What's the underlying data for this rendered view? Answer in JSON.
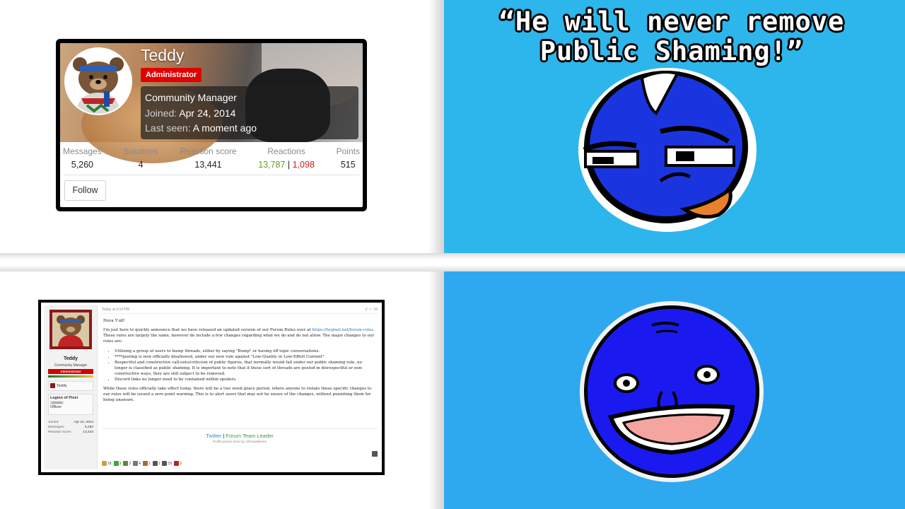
{
  "profile_card": {
    "username": "Teddy",
    "role_badge": "Administrator",
    "title": "Community Manager",
    "joined_label": "Joined:",
    "joined_value": "Apr 24, 2014",
    "last_seen_label": "Last seen:",
    "last_seen_value": "A moment ago",
    "stats": {
      "messages_label": "Messages",
      "messages_value": "5,260",
      "solutions_label": "Solutions",
      "solutions_value": "4",
      "reaction_score_label": "Reaction score",
      "reaction_score_value": "13,441",
      "reactions_label": "Reactions",
      "reactions_positive": "13,787",
      "reactions_separator": " | ",
      "reactions_negative": "1,098",
      "points_label": "Points",
      "points_value": "515"
    },
    "follow_label": "Follow"
  },
  "forum_post": {
    "timestamp": "Today at 4:14 PM",
    "post_number": "#3",
    "author": {
      "name": "Teddy",
      "title": "Community Manager",
      "badge": "Administrator",
      "team_name": "Teddy",
      "guild_name": "Legion of Pixel",
      "guild_tag": "LEGION",
      "guild_rank": "Officer",
      "joined_label": "Joined:",
      "joined_value": "Apr 24, 2014",
      "messages_label": "Messages:",
      "messages_value": "5,260",
      "reaction_score_label": "Reaction score:",
      "reaction_score_value": "13,443"
    },
    "greeting": "Heya Y'all!",
    "intro_before_link": "I'm just here to quickly announce that we have released an updated version of our Forum Rules over at ",
    "rules_link": "https://hypixel.net/forum-rules",
    "intro_after_link": ". These rules are largely the same, however do include a few changes regarding what we do and do not allow. The major changes to our rules are:",
    "bullets": [
      "Utilizing a group of users to bump threads, either by saying \"Bump\" or having off topic conversations.",
      "****posting is now officially disallowed, under our new rule against \"Low-Quality or Low-Effort Content\"",
      "Respectful and constructive call-outs/criticism of public figures, that normally would fall under our public shaming rule, no longer is classified as public shaming. It is important to note that if these sort of threads are posted in disrespectful or non-constructive ways, they are still subject to be removed.",
      "Discord links no longer need to be contained within spoilers."
    ],
    "closing": "While these rules officially take effect today, there will be a two week grace period, where anyone to violate these specific changes to our rules will be issued a zero point warning. This is to alert users that may not be aware of the changes, without punishing them for being unaware.",
    "signature": {
      "twitter": "Twitter",
      "separator": " | ",
      "forum_team_leader": "Forum Team Leader",
      "credit": "Profile picture done by: @Canadienne"
    },
    "reactions": [
      {
        "icon": "thumbs-up-icon",
        "count": "18",
        "color": "#c9a24a"
      },
      {
        "icon": "check-icon",
        "count": "3",
        "color": "#3aa63a"
      },
      {
        "icon": "creeper-icon",
        "count": "2",
        "color": "#5a8a3a"
      },
      {
        "icon": "pickaxe-icon",
        "count": "4",
        "color": "#777777"
      },
      {
        "icon": "chest-icon",
        "count": "1",
        "color": "#a0702a"
      },
      {
        "icon": "anvil-icon",
        "count": "1",
        "color": "#555555"
      },
      {
        "icon": "thumbs-down-icon",
        "count": "15",
        "color": "#555555"
      },
      {
        "icon": "cross-icon",
        "count": "3",
        "color": "#c02020"
      }
    ]
  },
  "meme_caption": {
    "line1": "“He will never remove",
    "line2": "Public Shaming!”"
  },
  "colors": {
    "admin_red": "#e10000",
    "positive_green": "#6a9b2c",
    "negative_red": "#c81e1e",
    "sky_blue_top": "#2db6ec",
    "sky_blue_bottom": "#2ea9f0",
    "character_blue": "#1133dd"
  }
}
